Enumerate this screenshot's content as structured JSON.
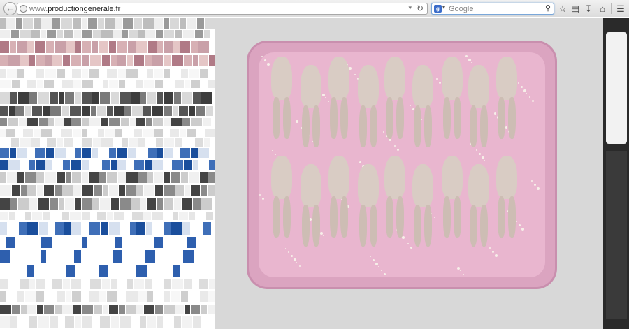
{
  "browser": {
    "url_prefix": "www.",
    "url_domain": "productiongenerale.fr",
    "search_placeholder": "Google",
    "search_engine_letter": "g"
  },
  "icons": {
    "back": "back-arrow-icon",
    "reload": "reload-icon",
    "bookmark": "star-icon",
    "bookmarks_menu": "clipboard-icon",
    "downloads": "download-icon",
    "home": "home-icon",
    "menu": "hamburger-menu-icon"
  },
  "colors": {
    "tray": "#dba4c0",
    "accent_blue": "#1a4e9c"
  }
}
